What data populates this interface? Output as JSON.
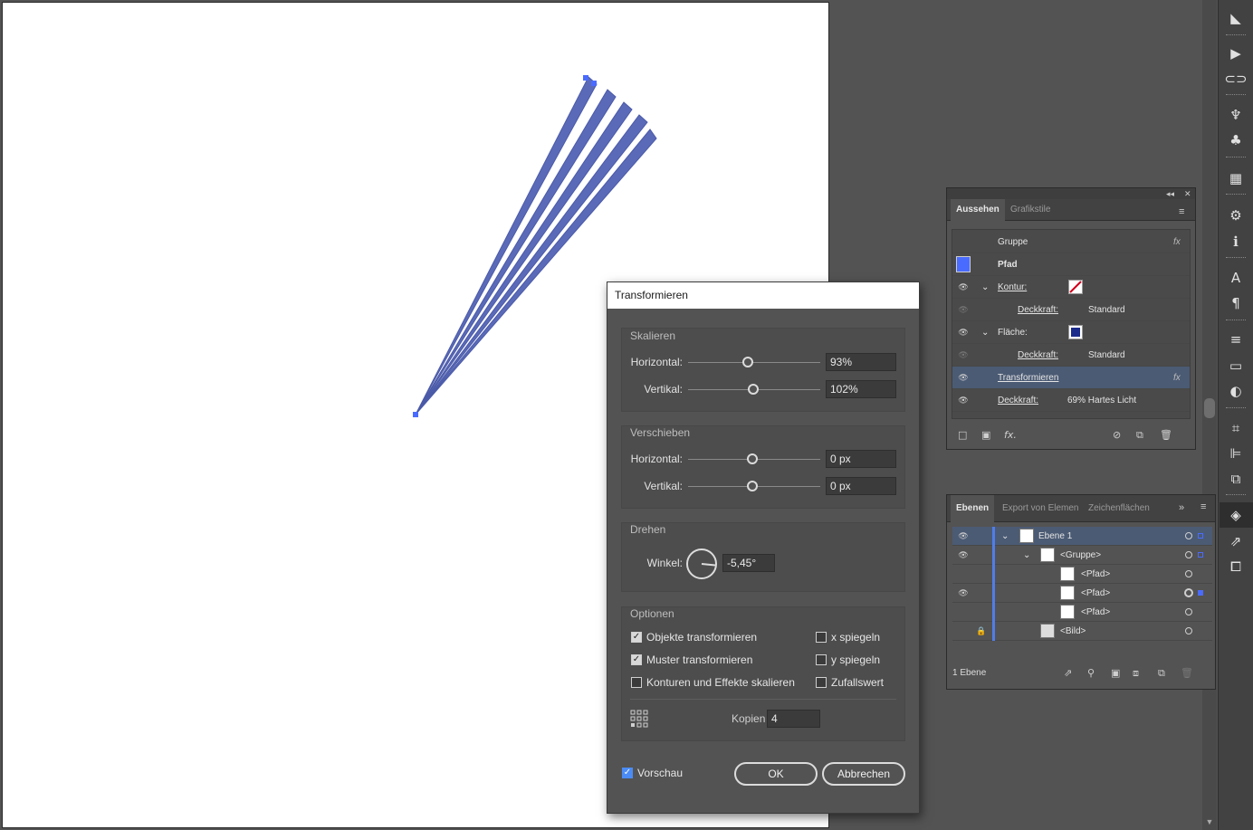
{
  "appearance_panel": {
    "tabs": [
      "Aussehen",
      "Grafikstile"
    ],
    "header_item": "Gruppe",
    "path_label": "Pfad",
    "rows": [
      {
        "label": "Kontur:",
        "value": ""
      },
      {
        "label": "Deckkraft:",
        "value": "Standard"
      },
      {
        "label": "Fläche:",
        "value": ""
      },
      {
        "label": "Deckkraft:",
        "value": "Standard"
      },
      {
        "label": "Transformieren",
        "value": ""
      },
      {
        "label": "Deckkraft:",
        "value": "69% Hartes Licht"
      }
    ],
    "fx_label": "fx"
  },
  "layers_panel": {
    "tabs": [
      "Ebenen",
      "Export von Elemen",
      "Zeichenflächen"
    ],
    "rows": [
      {
        "label": "Ebene 1"
      },
      {
        "label": "<Gruppe>"
      },
      {
        "label": "<Pfad>"
      },
      {
        "label": "<Pfad>"
      },
      {
        "label": "<Pfad>"
      },
      {
        "label": "<Bild>"
      }
    ],
    "footer": "1 Ebene"
  },
  "dialog": {
    "title": "Transformieren",
    "scale": {
      "label": "Skalieren",
      "horizontal_label": "Horizontal:",
      "horizontal_value": "93%",
      "vertical_label": "Vertikal:",
      "vertical_value": "102%"
    },
    "move": {
      "label": "Verschieben",
      "horizontal_label": "Horizontal:",
      "horizontal_value": "0 px",
      "vertical_label": "Vertikal:",
      "vertical_value": "0 px"
    },
    "rotate": {
      "label": "Drehen",
      "angle_label": "Winkel:",
      "angle_value": "-5,45°"
    },
    "options": {
      "label": "Optionen",
      "transform_objects": "Objekte transformieren",
      "transform_patterns": "Muster transformieren",
      "scale_strokes": "Konturen und Effekte skalieren",
      "reflect_x": "x spiegeln",
      "reflect_y": "y spiegeln",
      "random": "Zufallswert",
      "copies_label": "Kopien",
      "copies_value": "4"
    },
    "preview_label": "Vorschau",
    "ok_label": "OK",
    "cancel_label": "Abbrechen"
  },
  "colors": {
    "shape_fill": "#5b6ab8",
    "selection": "#4a6bff",
    "accent": "#4b8bf5"
  }
}
